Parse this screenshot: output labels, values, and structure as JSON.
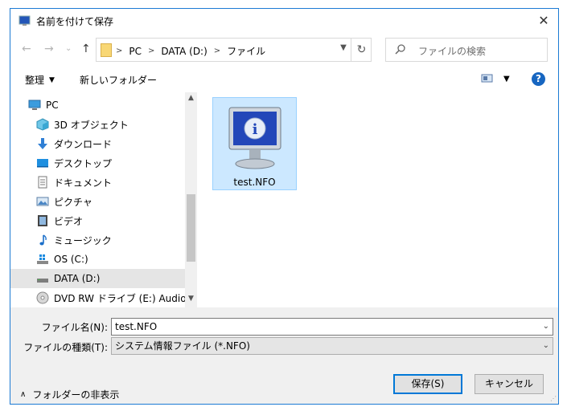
{
  "window": {
    "title": "名前を付けて保存",
    "close_label": "✕"
  },
  "nav": {
    "back_label": "←",
    "forward_label": "→",
    "dropdown_label": "⌄",
    "up_label": "↑",
    "breadcrumbs": [
      "PC",
      "DATA (D:)",
      "ファイル"
    ],
    "search_placeholder": "ファイルの検索"
  },
  "toolbar": {
    "organize_label": "整理",
    "new_folder_label": "新しいフォルダー"
  },
  "sidebar": {
    "items": [
      {
        "label": "PC",
        "icon": "pc-icon"
      },
      {
        "label": "3D オブジェクト",
        "icon": "cube-icon"
      },
      {
        "label": "ダウンロード",
        "icon": "download-icon"
      },
      {
        "label": "デスクトップ",
        "icon": "desktop-icon"
      },
      {
        "label": "ドキュメント",
        "icon": "document-icon"
      },
      {
        "label": "ピクチャ",
        "icon": "picture-icon"
      },
      {
        "label": "ビデオ",
        "icon": "video-icon"
      },
      {
        "label": "ミュージック",
        "icon": "music-icon"
      },
      {
        "label": "OS (C:)",
        "icon": "windows-drive-icon"
      },
      {
        "label": "DATA (D:)",
        "icon": "drive-icon"
      },
      {
        "label": "DVD RW ドライブ (E:) Audio CD",
        "icon": "dvd-icon"
      }
    ],
    "selected_index": 9
  },
  "files": [
    {
      "name": "test.NFO",
      "icon": "system-info-icon"
    }
  ],
  "form": {
    "filename_label": "ファイル名(N):",
    "filename_value": "test.NFO",
    "filetype_label": "ファイルの種類(T):",
    "filetype_value": "システム情報ファイル (*.NFO)"
  },
  "footer": {
    "hide_folders_label": "フォルダーの非表示",
    "save_label": "保存(S)",
    "cancel_label": "キャンセル"
  },
  "colors": {
    "accent": "#0078d7",
    "selection": "#cce8ff",
    "panel": "#f0f0f0"
  }
}
